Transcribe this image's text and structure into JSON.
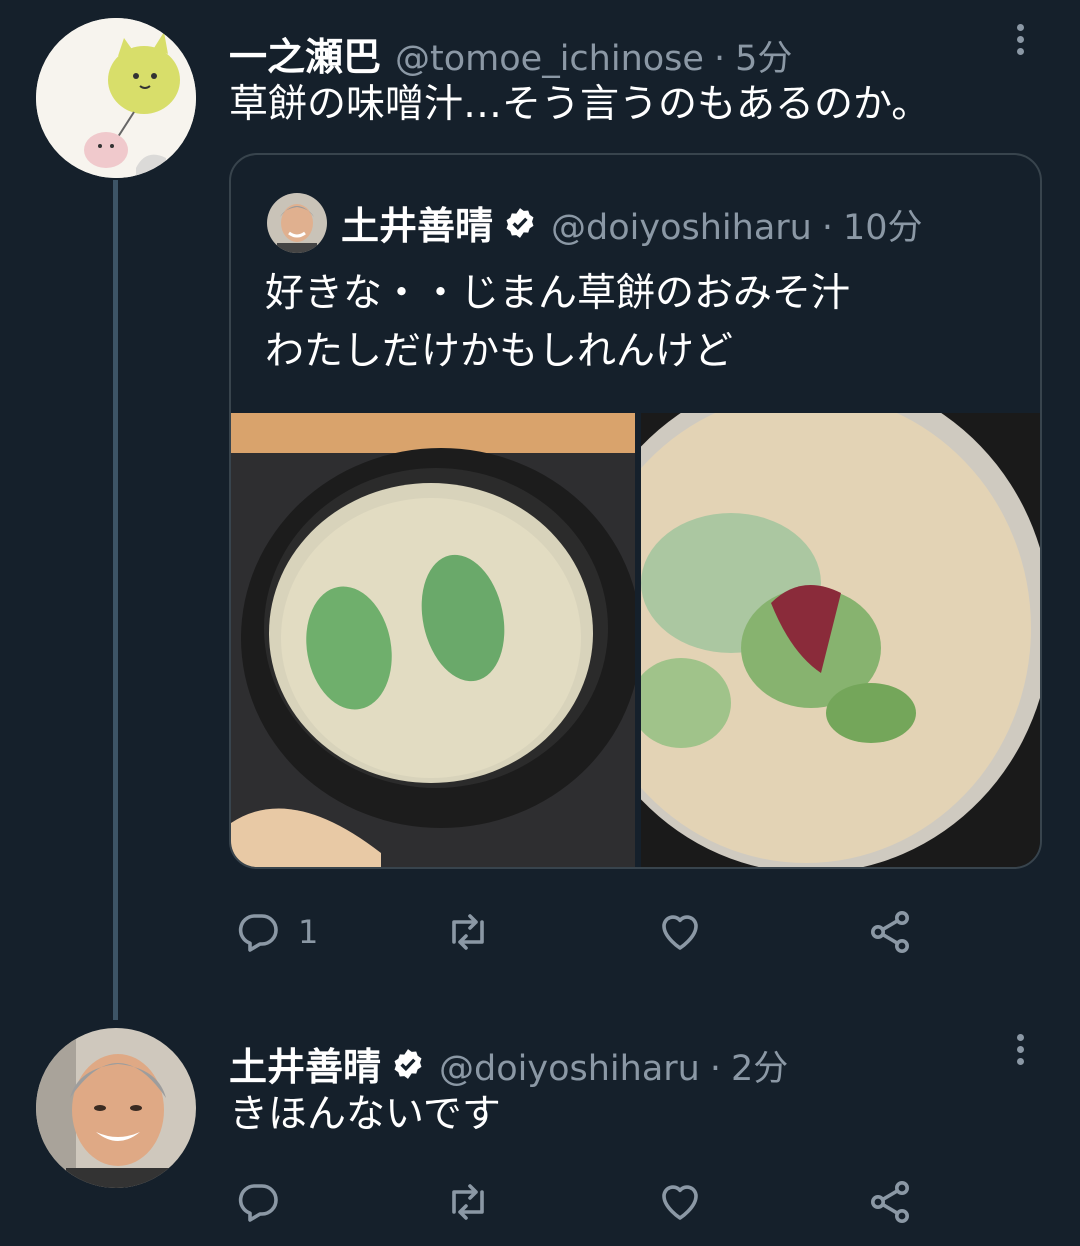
{
  "tweets": [
    {
      "display_name": "一之瀬巴",
      "handle": "@tomoe_ichinose",
      "separator": "·",
      "time": "5分",
      "text": "草餅の味噌汁…そう言うのもあるのか。",
      "quoted": {
        "display_name": "土井善晴",
        "handle": "@doiyoshiharu",
        "separator": "·",
        "time": "10分",
        "text_lines": [
          "好きな・・じまん草餅のおみそ汁",
          "わたしだけかもしれんけど"
        ]
      },
      "actions": {
        "reply_count": "1"
      }
    },
    {
      "display_name": "土井善晴",
      "handle": "@doiyoshiharu",
      "separator": "·",
      "time": "2分",
      "text": "きほんないです",
      "actions": {
        "reply_count": ""
      }
    }
  ],
  "icons": {
    "reply": "reply-icon",
    "retweet": "retweet-icon",
    "like": "heart-icon",
    "share": "share-icon",
    "more": "more-vertical-icon",
    "verified": "verified-badge-icon"
  },
  "colors": {
    "background": "#15202b",
    "secondary_text": "#8b98a5",
    "border": "#38444d",
    "thread_line": "#3d5466"
  }
}
